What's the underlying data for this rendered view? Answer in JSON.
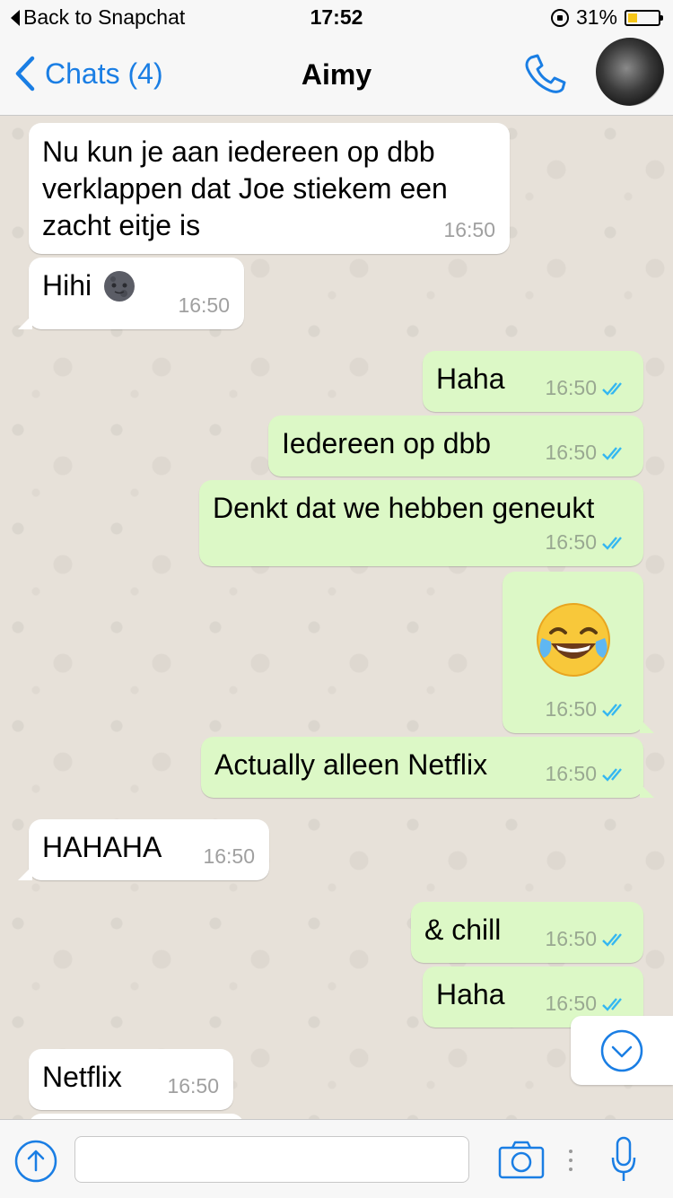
{
  "status_bar": {
    "back_label": "Back to Snapchat",
    "time": "17:52",
    "battery_percent": "31%",
    "battery_level": 0.31,
    "icons": [
      "orientation-lock-icon",
      "battery-icon"
    ]
  },
  "nav": {
    "back_label": "Chats (4)",
    "contact_name": "Aimy",
    "call_icon": "phone-icon",
    "avatar": "contact-avatar"
  },
  "colors": {
    "accent": "#1a7ee4",
    "incoming_bubble": "#ffffff",
    "outgoing_bubble": "#dcf8c6",
    "read_ticks": "#34b7f1"
  },
  "messages": [
    {
      "direction": "in",
      "text_lines": [
        "Nu kun je aan iedereen op dbb",
        "verklappen dat Joe stiekem een",
        "zacht eitje is"
      ],
      "time": "16:50"
    },
    {
      "direction": "in",
      "text": "Hihi",
      "emoji": "new-moon-face",
      "time": "16:50"
    },
    {
      "direction": "out",
      "text": "Haha",
      "time": "16:50",
      "status": "read"
    },
    {
      "direction": "out",
      "text": "Iedereen op dbb",
      "time": "16:50",
      "status": "read"
    },
    {
      "direction": "out",
      "text": "Denkt dat we hebben geneukt",
      "time": "16:50",
      "status": "read"
    },
    {
      "direction": "out",
      "emoji": "face-with-tears-of-joy",
      "time": "16:50",
      "status": "read"
    },
    {
      "direction": "out",
      "text": "Actually alleen Netflix",
      "time": "16:50",
      "status": "read"
    },
    {
      "direction": "in",
      "text": "HAHAHA",
      "time": "16:50"
    },
    {
      "direction": "out",
      "text": "& chill",
      "time": "16:50",
      "status": "read"
    },
    {
      "direction": "out",
      "text": "Haha",
      "time": "16:50",
      "status": "read"
    },
    {
      "direction": "in",
      "text": "Netflix",
      "time": "16:50"
    }
  ],
  "composer": {
    "attach_icon": "upload-arrow-icon",
    "input_value": "",
    "camera_icon": "camera-icon",
    "more_icon": "vertical-dots-icon",
    "mic_icon": "microphone-icon"
  },
  "scroll_button_icon": "chevron-down-icon"
}
